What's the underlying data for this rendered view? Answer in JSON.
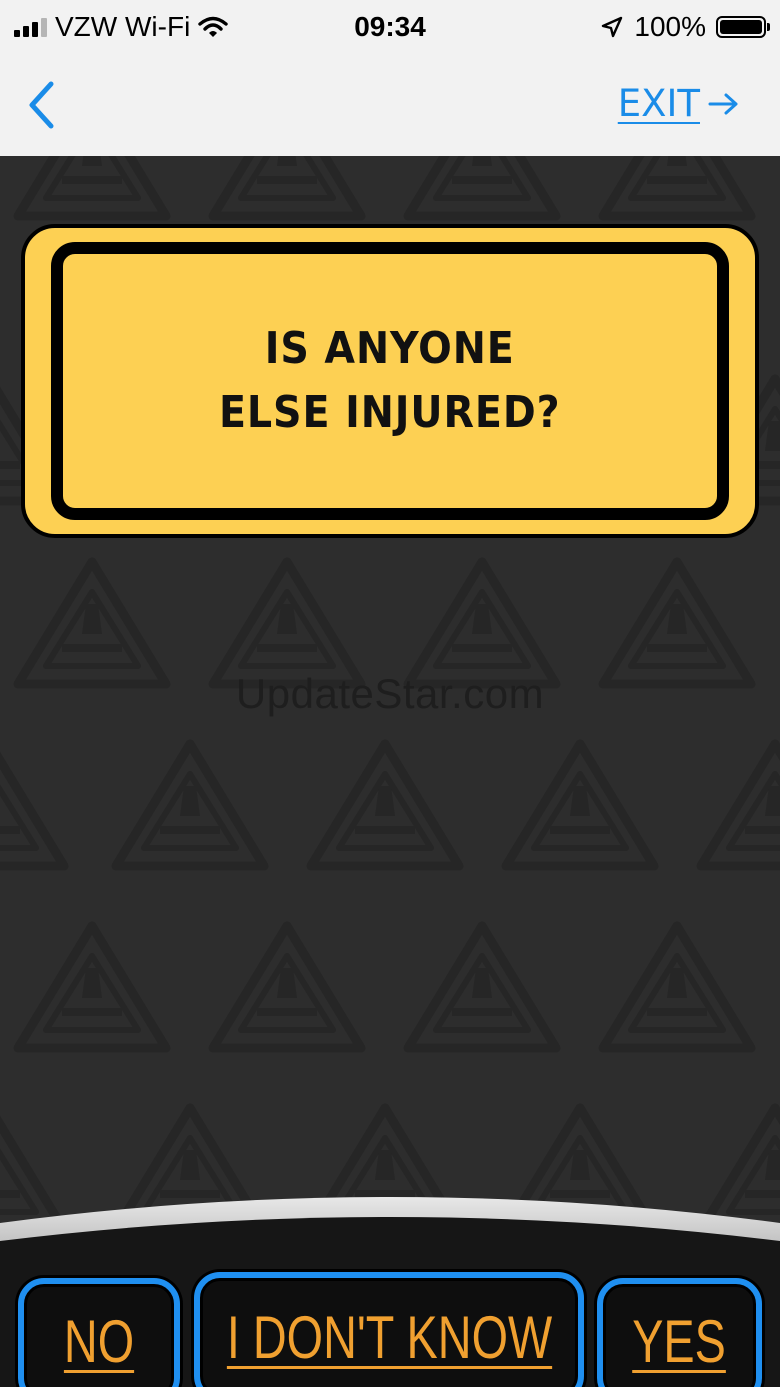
{
  "status_bar": {
    "carrier": "VZW Wi-Fi",
    "time": "09:34",
    "battery": "100%",
    "battery_level": 1.0,
    "icons": [
      "signal-icon",
      "wifi-icon",
      "location-arrow-icon",
      "battery-icon"
    ]
  },
  "nav": {
    "back_icon": "chevron-left-icon",
    "exit_label": "EXIT",
    "exit_icon": "arrow-right-icon"
  },
  "question": {
    "text": "IS ANYONE\nELSE INJURED?"
  },
  "watermark": {
    "text": "UpdateStar.com"
  },
  "answers": [
    {
      "label": "NO"
    },
    {
      "label": "I DON'T KNOW"
    },
    {
      "label": "YES"
    }
  ],
  "colors": {
    "bar_background": "#f2f2f2",
    "link_blue": "#1a8ce8",
    "page_background": "#2d2d2d",
    "card_yellow": "#fdd053",
    "button_border": "#1f8ff0",
    "button_text": "#f0a030"
  }
}
